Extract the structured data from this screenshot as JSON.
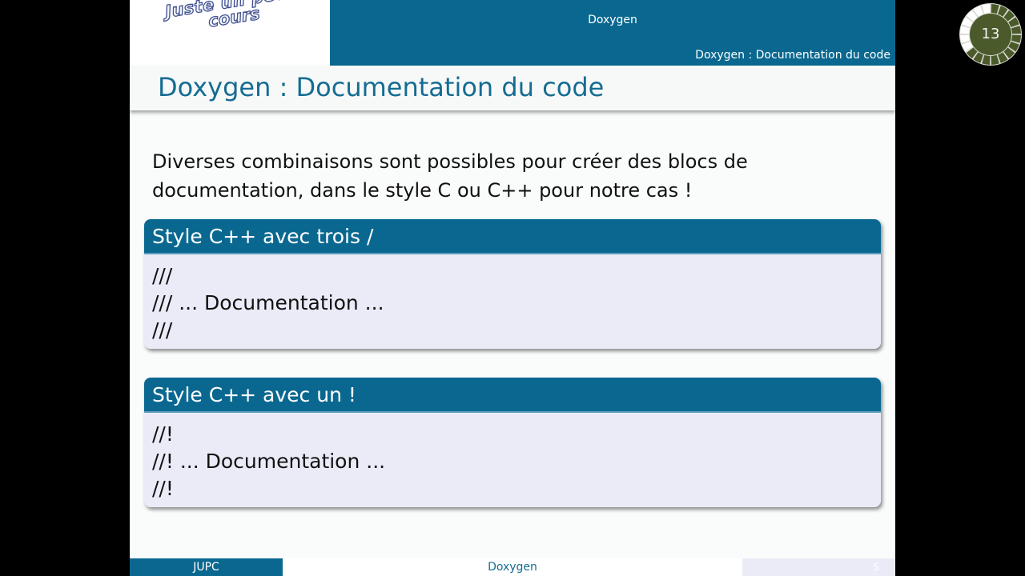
{
  "header": {
    "logo_line1": "Juste un petit",
    "logo_line2": "cours",
    "title": "Doxygen",
    "section": "Doxygen : Documentation du code"
  },
  "frame": {
    "title": "Doxygen : Documentation du code",
    "intro": "Diverses combinaisons sont possibles pour créer des blocs de documentation, dans le style C ou C++ pour notre cas !"
  },
  "blocks": [
    {
      "title": "Style C++ avec trois /",
      "lines": [
        "///",
        "/// ... Documentation ...",
        "///"
      ]
    },
    {
      "title": "Style C++ avec un !",
      "lines": [
        "//!",
        "//! ... Documentation ...",
        "//!"
      ]
    }
  ],
  "footer": {
    "author": "JUPC",
    "title": "Doxygen",
    "page": "5"
  },
  "progress": {
    "label": "13",
    "fraction": 0.65,
    "colors": {
      "done": "#4a5a2a",
      "remaining": "#ffffff",
      "center": "#4a5a2a"
    }
  },
  "colors": {
    "accent": "#0a6890",
    "title_text": "#156c93",
    "block_body": "#ebebf7"
  }
}
